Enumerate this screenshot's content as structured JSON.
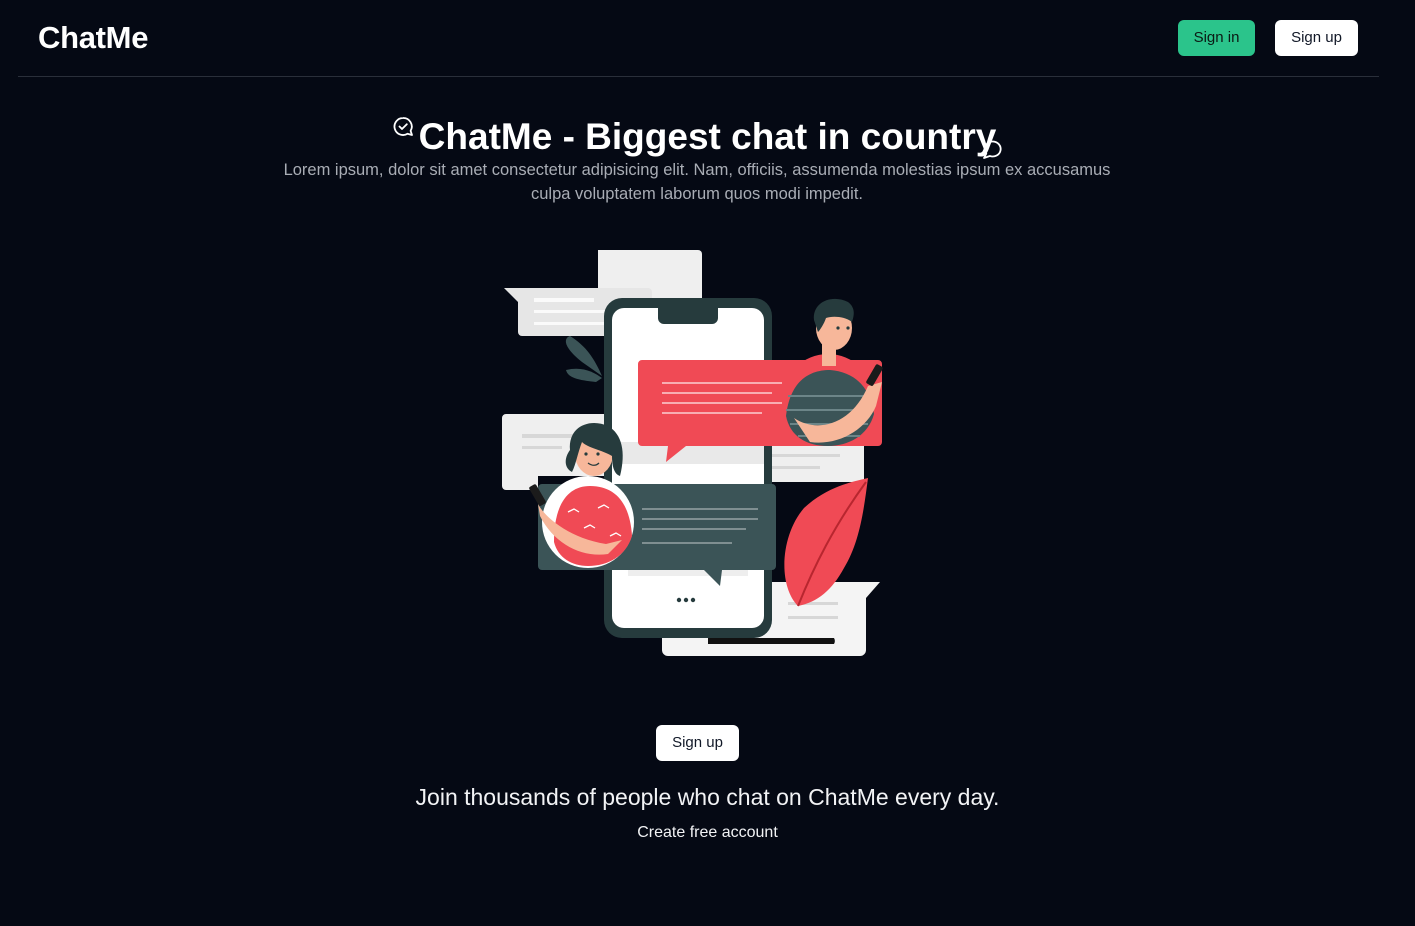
{
  "header": {
    "logo": "ChatMe",
    "signin_label": "Sign in",
    "signup_label": "Sign up"
  },
  "hero": {
    "title": "ChatMe - Biggest chat in country",
    "description": "Lorem ipsum, dolor sit amet consectetur adipisicing elit. Nam, officiis, assumenda molestias ipsum ex accusamus culpa voluptatem laborum quos modi impedit.",
    "left_icon": "chat-check-icon",
    "right_icon": "speech-bubble-icon"
  },
  "illustration": {
    "name": "people-chatting-on-phone-illustration",
    "typing_indicator": "•••"
  },
  "cta": {
    "signup_label": "Sign up",
    "join_text": "Join thousands of people who chat on ChatMe every day.",
    "create_account_label": "Create free account"
  },
  "colors": {
    "background": "#050914",
    "accent_green": "#2bc48b",
    "bubble_red": "#f04a55",
    "bubble_dark": "#3b5457"
  }
}
